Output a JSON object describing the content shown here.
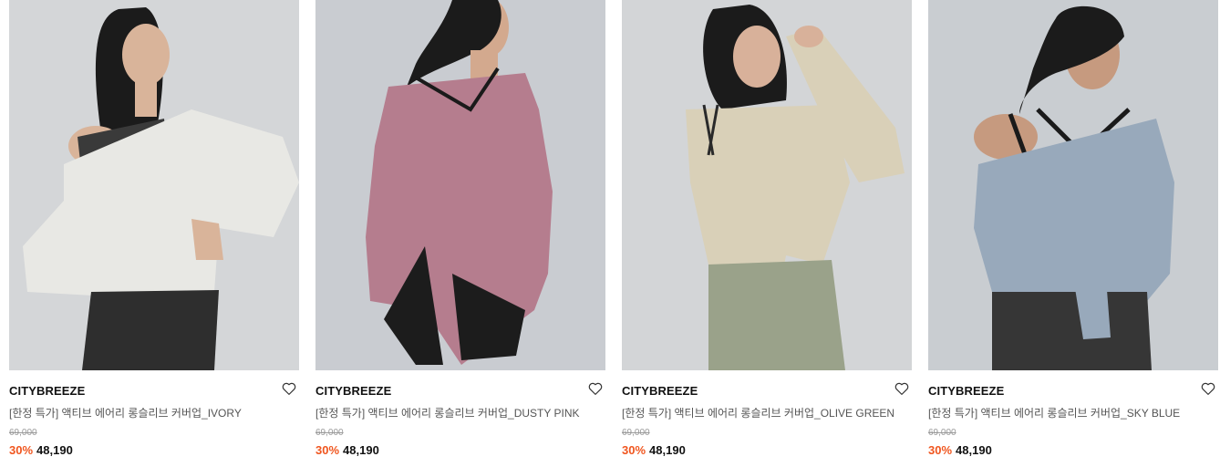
{
  "products": [
    {
      "brand": "CITYBREEZE",
      "name": "[한정 특가] 액티브 에어리 롱슬리브 커버업_IVORY",
      "original_price": "69,000",
      "discount": "30%",
      "price": "48,190",
      "colors": {
        "backdrop": "#d4d6d8",
        "garment": "#e8e8e4",
        "bottom": "#2e2e2e",
        "skin": "#d9b49a"
      }
    },
    {
      "brand": "CITYBREEZE",
      "name": "[한정 특가] 액티브 에어리 롱슬리브 커버업_DUSTY PINK",
      "original_price": "69,000",
      "discount": "30%",
      "price": "48,190",
      "colors": {
        "backdrop": "#c9ccd1",
        "garment": "#b57d8e",
        "bottom": "#1c1c1c",
        "skin": "#d3a98e"
      }
    },
    {
      "brand": "CITYBREEZE",
      "name": "[한정 특가] 액티브 에어리 롱슬리브 커버업_OLIVE GREEN",
      "original_price": "69,000",
      "discount": "30%",
      "price": "48,190",
      "colors": {
        "backdrop": "#d3d5d7",
        "garment": "#d9d0b8",
        "bottom": "#9aa28a",
        "skin": "#d8b19a"
      }
    },
    {
      "brand": "CITYBREEZE",
      "name": "[한정 특가] 액티브 에어리 롱슬리브 커버업_SKY BLUE",
      "original_price": "69,000",
      "discount": "30%",
      "price": "48,190",
      "colors": {
        "backdrop": "#c9cdd1",
        "garment": "#98a9bb",
        "bottom": "#363636",
        "skin": "#c69a7f"
      }
    }
  ],
  "icons": {
    "wishlist": "heart-outline-icon"
  }
}
